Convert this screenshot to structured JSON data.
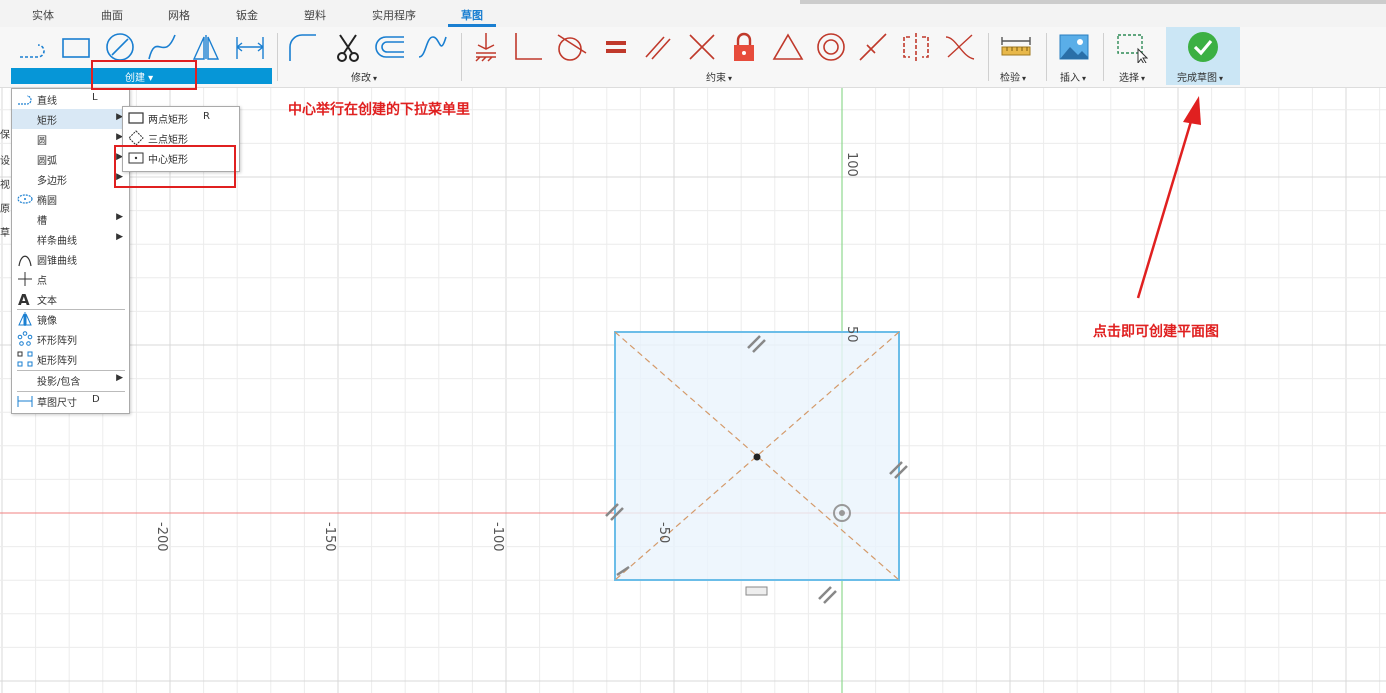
{
  "tabs": [
    {
      "label": "实体",
      "active": false
    },
    {
      "label": "曲面",
      "active": false
    },
    {
      "label": "网格",
      "active": false
    },
    {
      "label": "钣金",
      "active": false
    },
    {
      "label": "塑料",
      "active": false
    },
    {
      "label": "实用程序",
      "active": false
    },
    {
      "label": "草图",
      "active": true
    }
  ],
  "toolbar": {
    "groups": {
      "create": "创建",
      "modify": "修改",
      "constraints": "约束",
      "inspect": "检验",
      "insert": "插入",
      "select": "选择",
      "finish": "完成草图"
    }
  },
  "create_menu": {
    "items": [
      {
        "label": "直线",
        "shortcut": "L",
        "has_submenu": false,
        "icon": "line-icon"
      },
      {
        "label": "矩形",
        "shortcut": "",
        "has_submenu": true,
        "icon": "",
        "highlighted": true
      },
      {
        "label": "圆",
        "shortcut": "",
        "has_submenu": true,
        "icon": ""
      },
      {
        "label": "圆弧",
        "shortcut": "",
        "has_submenu": true,
        "icon": ""
      },
      {
        "label": "多边形",
        "shortcut": "",
        "has_submenu": true,
        "icon": ""
      },
      {
        "label": "椭圆",
        "shortcut": "",
        "has_submenu": false,
        "icon": "ellipse-icon"
      },
      {
        "label": "槽",
        "shortcut": "",
        "has_submenu": true,
        "icon": ""
      },
      {
        "label": "样条曲线",
        "shortcut": "",
        "has_submenu": true,
        "icon": ""
      },
      {
        "label": "圆锥曲线",
        "shortcut": "",
        "has_submenu": false,
        "icon": "conic-curve-icon"
      },
      {
        "label": "点",
        "shortcut": "",
        "has_submenu": false,
        "icon": "point-icon"
      },
      {
        "label": "文本",
        "shortcut": "",
        "has_submenu": false,
        "icon": "text-icon"
      },
      {
        "label": "镜像",
        "shortcut": "",
        "has_submenu": false,
        "icon": "mirror-icon"
      },
      {
        "label": "环形阵列",
        "shortcut": "",
        "has_submenu": false,
        "icon": "circular-pattern-icon"
      },
      {
        "label": "矩形阵列",
        "shortcut": "",
        "has_submenu": false,
        "icon": "rectangular-pattern-icon"
      },
      {
        "label": "投影/包含",
        "shortcut": "",
        "has_submenu": true,
        "icon": ""
      },
      {
        "label": "草图尺寸",
        "shortcut": "D",
        "has_submenu": false,
        "icon": "sketch-dimension-icon"
      }
    ]
  },
  "rect_submenu": {
    "items": [
      {
        "label": "两点矩形",
        "shortcut": "R",
        "icon": "two-point-rectangle-icon"
      },
      {
        "label": "三点矩形",
        "shortcut": "",
        "icon": "three-point-rectangle-icon"
      },
      {
        "label": "中心矩形",
        "shortcut": "",
        "icon": "center-rectangle-icon"
      }
    ]
  },
  "left_strip": [
    "保",
    "设",
    "视",
    "原",
    "草"
  ],
  "annotations": {
    "menu_note": "中心举行在创建的下拉菜单里",
    "finish_note": "点击即可创建平面图"
  },
  "axis_labels": {
    "x": [
      "-200",
      "-150",
      "-100",
      "-50"
    ],
    "y": [
      "100",
      "50"
    ]
  },
  "colors": {
    "accent": "#0696d7",
    "active_tab": "#1a7fd1",
    "annotation_red": "#e02020",
    "sketch_blue": "#6bbde8",
    "construction_orange": "#d49a6a",
    "x_axis": "#f08080",
    "y_axis": "#8fd88f"
  }
}
